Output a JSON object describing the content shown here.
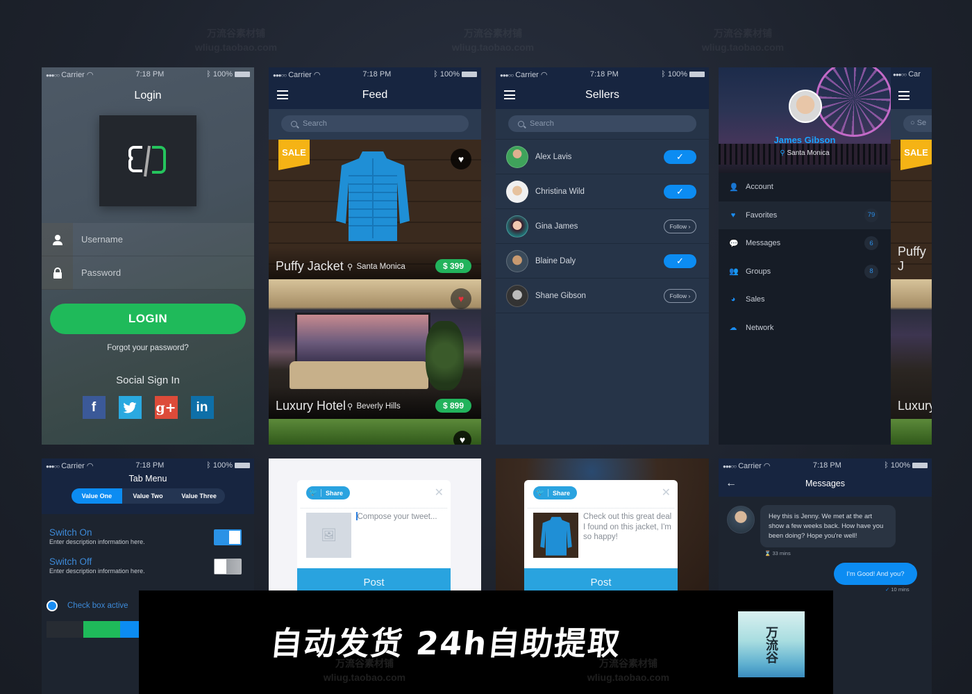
{
  "status_bar": {
    "carrier": "Carrier",
    "signal": "●●●○○",
    "time": "7:18 PM",
    "battery": "100%"
  },
  "watermark": {
    "line1": "万流谷素材铺",
    "line2": "wliug.taobao.com"
  },
  "login": {
    "title": "Login",
    "username_placeholder": "Username",
    "password_placeholder": "Password",
    "login_button": "LOGIN",
    "forgot_link": "Forgot your password?",
    "social_title": "Social Sign In",
    "social": [
      {
        "name": "facebook",
        "glyph": "f",
        "color": "#3b5998"
      },
      {
        "name": "twitter",
        "glyph": "🐦",
        "color": "#2aa9e0"
      },
      {
        "name": "google-plus",
        "glyph": "g+",
        "color": "#dd4b39"
      },
      {
        "name": "linkedin",
        "glyph": "in",
        "color": "#0e6fa8"
      }
    ]
  },
  "feed": {
    "title": "Feed",
    "search_placeholder": "Search",
    "items": [
      {
        "badge": "SALE",
        "name": "Puffy Jacket",
        "location": "Santa Monica",
        "price": "$ 399",
        "favorited": false
      },
      {
        "badge": "",
        "name": "Luxury Hotel",
        "location": "Beverly Hills",
        "price": "$ 899",
        "favorited": true
      },
      {
        "badge": "",
        "name": "",
        "location": "",
        "price": "",
        "favorited": false
      }
    ]
  },
  "sellers": {
    "title": "Sellers",
    "search_placeholder": "Search",
    "follow_label": "Follow ›",
    "list": [
      {
        "name": "Alex Lavis",
        "following": true,
        "avatar_color": "#3fa35b"
      },
      {
        "name": "Christina Wild",
        "following": true,
        "avatar_color": "#d9c3a8"
      },
      {
        "name": "Gina James",
        "following": false,
        "avatar_color": "#a03a6a"
      },
      {
        "name": "Blaine Daly",
        "following": true,
        "avatar_color": "#8a6a4a"
      },
      {
        "name": "Shane Gibson",
        "following": false,
        "avatar_color": "#4a4a4a"
      }
    ]
  },
  "drawer": {
    "profile_name": "James Gibson",
    "profile_location": "Santa Monica",
    "items": [
      {
        "label": "Account",
        "icon": "👤",
        "count": ""
      },
      {
        "label": "Favorites",
        "icon": "♥",
        "count": "79"
      },
      {
        "label": "Messages",
        "icon": "💬",
        "count": "6"
      },
      {
        "label": "Groups",
        "icon": "👥",
        "count": "8"
      },
      {
        "label": "Sales",
        "icon": "◕",
        "count": ""
      },
      {
        "label": "Network",
        "icon": "☁",
        "count": ""
      }
    ],
    "active_index": 1,
    "peek": {
      "badge": "SALE",
      "name": "Puffy J",
      "name2": "Luxury",
      "search": "Se"
    }
  },
  "tab_menu": {
    "title": "Tab Menu",
    "tabs": [
      "Value One",
      "Value Two",
      "Value Three"
    ],
    "active_tab": 0,
    "switch_on": {
      "title": "Switch On",
      "desc": "Enter description information here.",
      "state": true
    },
    "switch_off": {
      "title": "Switch Off",
      "desc": "Enter description information here.",
      "state": false
    },
    "checkbox_label": "Check box active",
    "swatches": [
      "#272c33",
      "#1fba5a",
      "#0c8cf2"
    ]
  },
  "tweet_compose": {
    "share_label": "Share",
    "placeholder": "Compose your tweet...",
    "post_label": "Post"
  },
  "tweet_filled": {
    "share_label": "Share",
    "text": "Check out this great deal I found on this jacket, I'm so happy!",
    "post_label": "Post"
  },
  "messages": {
    "title": "Messages",
    "incoming": {
      "text": "Hey this is Jenny. We met at the art show a few weeks back. How have you been doing? Hope you're well!",
      "time": "33 mins"
    },
    "outgoing": {
      "text": "I'm Good! And you?",
      "time": "10 mins"
    }
  },
  "banner": {
    "text": "自动发货 24h自助提取",
    "logo_text": "万流谷"
  },
  "colors": {
    "accent": "#0c8cf2",
    "green": "#1fba5a",
    "sale": "#f5b315",
    "navy": "#172540"
  }
}
